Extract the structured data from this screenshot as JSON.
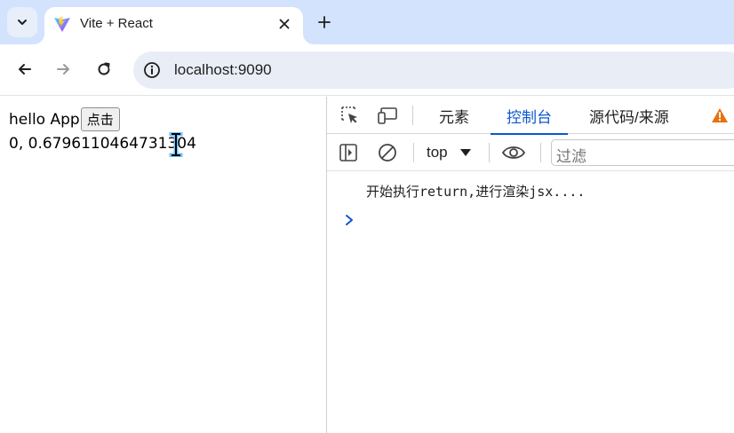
{
  "browser": {
    "tab": {
      "title": "Vite + React"
    },
    "address_bar": {
      "url": "localhost:9090"
    }
  },
  "page": {
    "text_line1": "hello App",
    "button_label": "点击",
    "text_line2": "0, 0.6796110464731304"
  },
  "devtools": {
    "tabs": [
      {
        "label": "元素",
        "active": false
      },
      {
        "label": "控制台",
        "active": true
      },
      {
        "label": "源代码/来源",
        "active": false
      }
    ],
    "console": {
      "context": "top",
      "filter_placeholder": "过滤",
      "messages": [
        "开始执行return,进行渲染jsx...."
      ]
    }
  },
  "colors": {
    "tabstrip_bg": "#d3e3fd",
    "accent": "#0b57d0",
    "warning": "#e8710a"
  }
}
